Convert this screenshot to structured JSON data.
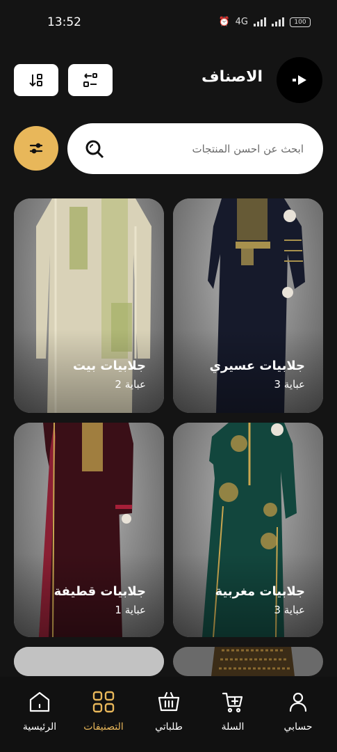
{
  "status_bar": {
    "time": "13:52",
    "network": "4G",
    "battery": "100"
  },
  "header": {
    "title": "الاصناف",
    "logo_icon": "play-logo-icon",
    "sort_icon": "sort-icon",
    "view_icon": "view-toggle-icon"
  },
  "search": {
    "placeholder": "ابحث عن احسن المنتجات",
    "value": "",
    "icon": "search-icon",
    "filter_icon": "filter-sliders-icon"
  },
  "categories": [
    {
      "name": "جلابيات عسيري",
      "count": "عباية 3"
    },
    {
      "name": "جلابيات بيت",
      "count": "عباية 2"
    },
    {
      "name": "جلابيات مغربية",
      "count": "عباية 3"
    },
    {
      "name": "جلابيات قطيفة",
      "count": "عباية 1"
    }
  ],
  "bottom_nav": [
    {
      "label": "حسابي",
      "icon": "user-icon"
    },
    {
      "label": "السلة",
      "icon": "cart-icon"
    },
    {
      "label": "طلباتي",
      "icon": "basket-icon"
    },
    {
      "label": "التصنيفات",
      "icon": "categories-grid-icon",
      "active": true
    },
    {
      "label": "الرئيسية",
      "icon": "home-icon"
    }
  ],
  "colors": {
    "background": "#141414",
    "accent": "#e8b75a",
    "surface": "#ffffff"
  }
}
